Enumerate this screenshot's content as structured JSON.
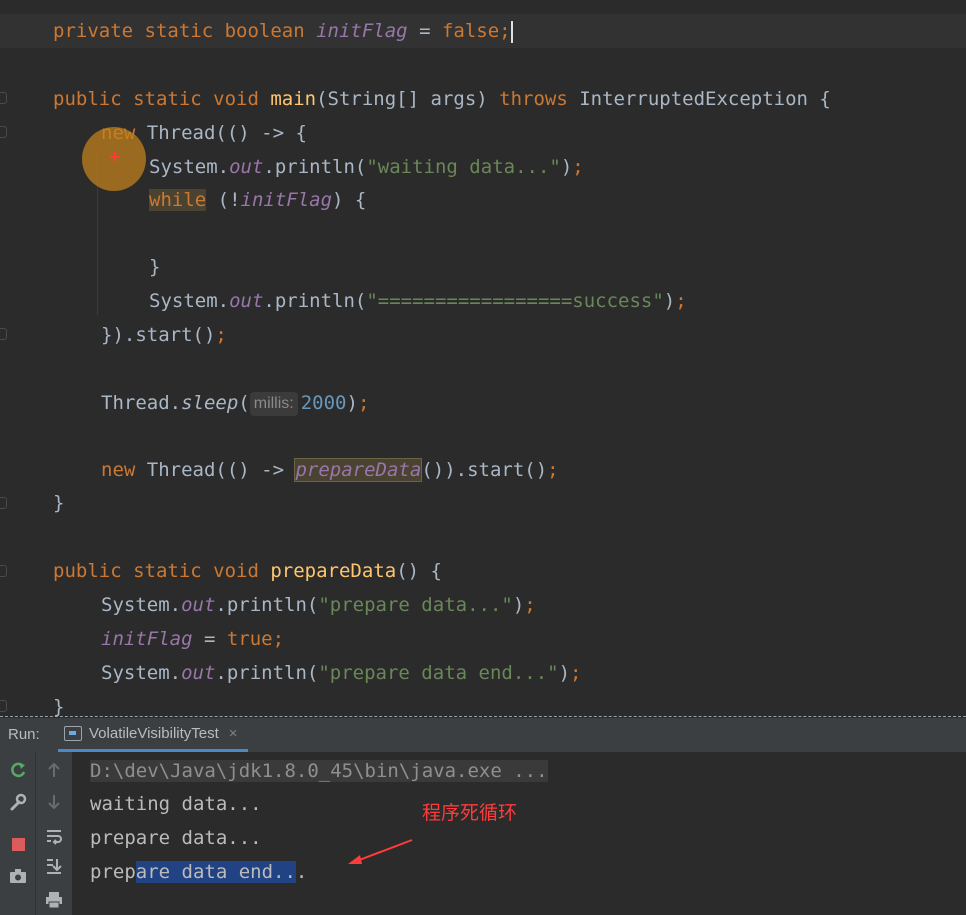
{
  "editor": {
    "lines": [
      {
        "id": "l1",
        "tokens": [
          [
            "kw",
            "private static boolean "
          ],
          [
            "fld",
            "initFlag"
          ],
          [
            "p",
            " = "
          ],
          [
            "kw",
            "false;"
          ]
        ]
      },
      {
        "id": "l2",
        "tokens": [
          [
            "kw",
            "public static void "
          ],
          [
            "fn",
            "main"
          ],
          [
            "p",
            "(String[] args) "
          ],
          [
            "kw",
            "throws "
          ],
          [
            "p",
            "InterruptedException {"
          ]
        ]
      },
      {
        "id": "l3",
        "tokens": [
          [
            "kw",
            "new "
          ],
          [
            "p",
            "Thread(() -> {"
          ]
        ]
      },
      {
        "id": "l4",
        "tokens": [
          [
            "p",
            "System."
          ],
          [
            "fld",
            "out"
          ],
          [
            "p",
            ".println("
          ],
          [
            "str",
            "\"waiting data...\""
          ],
          [
            "p",
            ")"
          ],
          [
            "kw",
            ";"
          ]
        ]
      },
      {
        "id": "l5",
        "tokens": [
          [
            "while",
            "while"
          ],
          [
            "p",
            " (!"
          ],
          [
            "fld",
            "initFlag"
          ],
          [
            "p",
            ") {"
          ]
        ]
      },
      {
        "id": "l6",
        "tokens": [
          [
            "p",
            "}"
          ]
        ]
      },
      {
        "id": "l7",
        "tokens": [
          [
            "p",
            "System."
          ],
          [
            "fld",
            "out"
          ],
          [
            "p",
            ".println("
          ],
          [
            "str",
            "\"=================success\""
          ],
          [
            "p",
            ")"
          ],
          [
            "kw",
            ";"
          ]
        ]
      },
      {
        "id": "l8",
        "tokens": [
          [
            "p",
            "}).start()"
          ],
          [
            "kw",
            ";"
          ]
        ]
      },
      {
        "id": "l9",
        "tokens": [
          [
            "p",
            "Thread."
          ],
          [
            "st",
            "sleep"
          ],
          [
            "p",
            "("
          ],
          [
            "hint",
            "millis:"
          ],
          [
            "num",
            "2000"
          ],
          [
            "p",
            ")"
          ],
          [
            "kw",
            ";"
          ]
        ]
      },
      {
        "id": "l10",
        "tokens": [
          [
            "kw",
            "new "
          ],
          [
            "p",
            "Thread(() -> "
          ],
          [
            "prep",
            "prepareData"
          ],
          [
            "p",
            "()).start()"
          ],
          [
            "kw",
            ";"
          ]
        ]
      },
      {
        "id": "l11",
        "tokens": [
          [
            "p",
            "}"
          ]
        ]
      },
      {
        "id": "l12",
        "tokens": [
          [
            "kw",
            "public static void "
          ],
          [
            "fn",
            "prepareData"
          ],
          [
            "p",
            "() {"
          ]
        ]
      },
      {
        "id": "l13",
        "tokens": [
          [
            "p",
            "System."
          ],
          [
            "fld",
            "out"
          ],
          [
            "p",
            ".println("
          ],
          [
            "str",
            "\"prepare data...\""
          ],
          [
            "p",
            ")"
          ],
          [
            "kw",
            ";"
          ]
        ]
      },
      {
        "id": "l14",
        "tokens": [
          [
            "fld",
            "initFlag"
          ],
          [
            "p",
            " = "
          ],
          [
            "kw",
            "true;"
          ]
        ]
      },
      {
        "id": "l15",
        "tokens": [
          [
            "p",
            "System."
          ],
          [
            "fld",
            "out"
          ],
          [
            "p",
            ".println("
          ],
          [
            "str",
            "\"prepare data end...\""
          ],
          [
            "p",
            ")"
          ],
          [
            "kw",
            ";"
          ]
        ]
      },
      {
        "id": "l16",
        "tokens": [
          [
            "p",
            "}"
          ]
        ]
      }
    ]
  },
  "run_panel": {
    "label": "Run:",
    "tab_title": "VolatileVisibilityTest",
    "tab_close": "×",
    "console": {
      "cmd": "D:\\dev\\Java\\jdk1.8.0_45\\bin\\java.exe ...",
      "line1": "waiting data...",
      "line2": "prepare data...",
      "line3_pre": "prep",
      "line3_sel": "are data end..",
      "line3_post": "."
    }
  },
  "annotation": {
    "text": "程序死循环",
    "color": "#ff3b3b"
  },
  "colors": {
    "keyword": "#cc7832",
    "field": "#9876aa",
    "method_decl": "#ffc66d",
    "string": "#6a8759",
    "number": "#6897bb",
    "plain": "#a9b7c6",
    "editor_bg": "#2b2b2b",
    "panel_bg": "#3c3f41",
    "selection": "#214283"
  }
}
